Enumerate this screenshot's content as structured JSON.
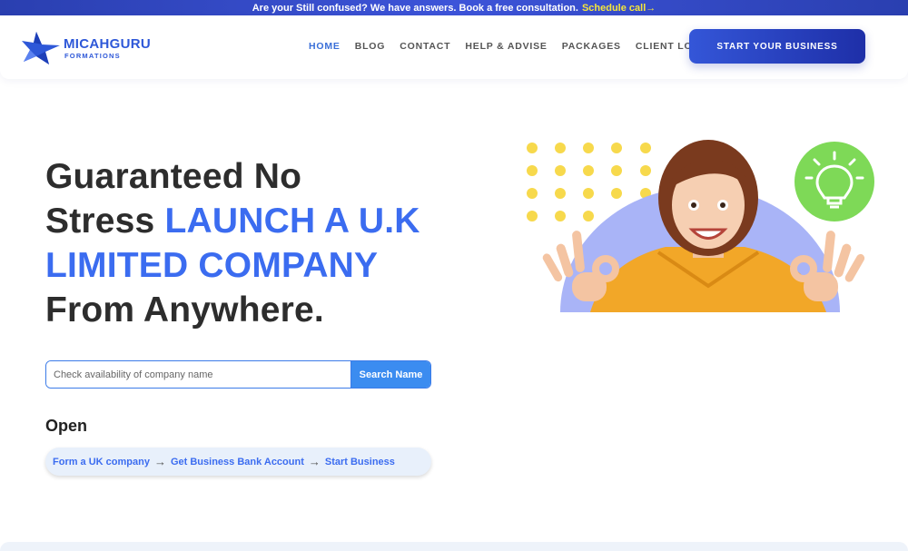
{
  "topbar": {
    "message": "Are your Still confused? We have answers. Book a free consultation.",
    "cta": "Schedule call→"
  },
  "header": {
    "logo": {
      "main": "MICAHGURU",
      "sub": "FORMATIONS"
    },
    "nav": [
      {
        "label": "HOME",
        "active": true
      },
      {
        "label": "BLOG"
      },
      {
        "label": "CONTACT"
      },
      {
        "label": "HELP & ADVISE"
      },
      {
        "label": "PACKAGES"
      },
      {
        "label": "CLIENT LOGIN"
      }
    ],
    "start_button": "START YOUR BUSINESS"
  },
  "hero": {
    "title_line1": "Guaranteed No",
    "title_line2_plain": "Stress",
    "title_line2_blue": "LAUNCH A U.K",
    "title_line3_blue": "LIMITED COMPANY",
    "title_line4": "From Anywhere.",
    "search": {
      "placeholder": "Check availability of company name",
      "value": "",
      "button": "Search Name"
    },
    "open_label": "Open",
    "steps": [
      "Form a UK company",
      "Get Business Bank Account",
      "Start Business"
    ],
    "step_arrow": "→"
  },
  "colors": {
    "accent_blue": "#3b6cf0",
    "topbar": "#2a3fb0",
    "cta_yellow": "#f5e63a",
    "bulb_green": "#7ed957",
    "hoodie": "#f2a728"
  },
  "icons": [
    "logo-star-icon",
    "lightbulb-icon",
    "arrow-right-icon"
  ]
}
